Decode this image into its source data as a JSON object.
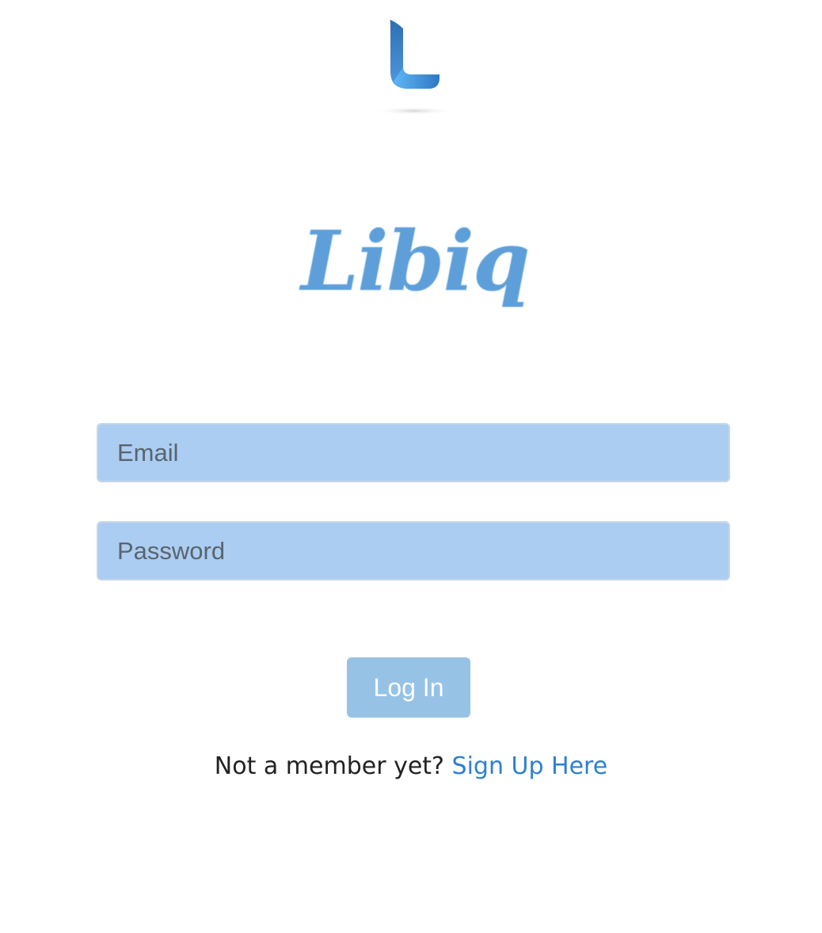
{
  "brand": {
    "wordmark": "Libiq",
    "icon": "libiq-l-logo-icon",
    "color": "#5e9fd9"
  },
  "login_form": {
    "email_placeholder": "Email",
    "password_placeholder": "Password",
    "field_bg": "#abcdf1",
    "submit_label": "Log In",
    "submit_bg": "#96c2e6"
  },
  "signup": {
    "prompt": "Not a member yet?",
    "link_label": "Sign Up Here",
    "link_color": "#2f7fd0"
  }
}
